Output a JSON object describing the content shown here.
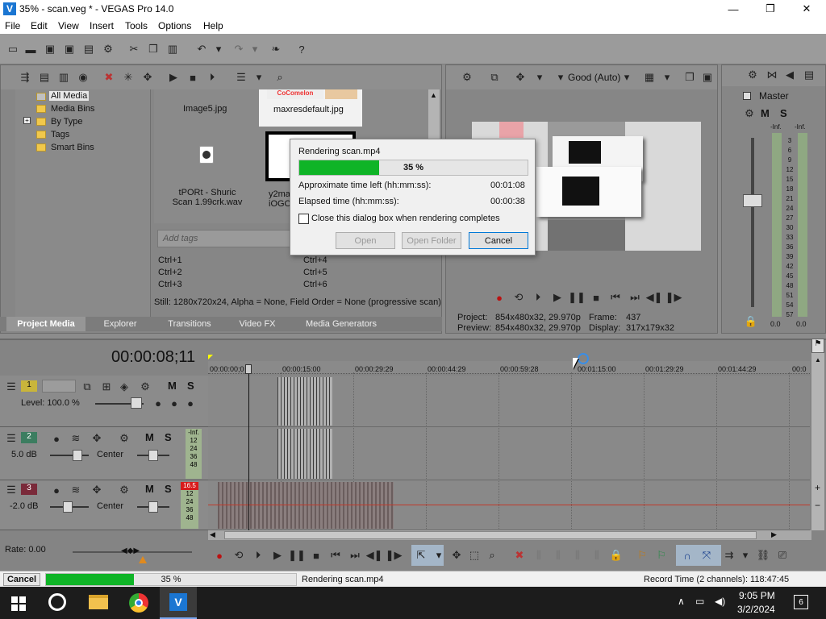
{
  "window": {
    "title": "35% - scan.veg * - VEGAS Pro 14.0",
    "minimize": "—",
    "maximize": "❐",
    "close": "✕"
  },
  "menu": [
    "File",
    "Edit",
    "View",
    "Insert",
    "Tools",
    "Options",
    "Help"
  ],
  "media_tree": [
    "All Media",
    "Media Bins",
    "By Type",
    "Tags",
    "Smart Bins"
  ],
  "tree_expand": "+",
  "media_files": [
    "Image5.jpg",
    "maxresdefault.jpg",
    "tPORt - Shuric Scan 1.99crk.wav",
    "y2ma",
    "iOGO"
  ],
  "cocomelon": "CoComelon",
  "tags": {
    "placeholder": "Add tags",
    "shortcuts": [
      "Ctrl+1",
      "Ctrl+2",
      "Ctrl+3",
      "Ctrl+4",
      "Ctrl+5",
      "Ctrl+6"
    ]
  },
  "media_status": "Still: 1280x720x24, Alpha = None, Field Order = None (progressive scan)",
  "tabs": [
    "Project Media",
    "Explorer",
    "Transitions",
    "Video FX",
    "Media Generators"
  ],
  "preview": {
    "quality": "Good (Auto)",
    "project_label": "Project:",
    "project": "854x480x32, 29.970p",
    "preview_label": "Preview:",
    "preview": "854x480x32, 29.970p",
    "frame_label": "Frame:",
    "frame": "437",
    "display_label": "Display:",
    "display": "317x179x32"
  },
  "master": {
    "label": "Master",
    "m": "M",
    "s": "S",
    "inf_l": "-Inf.",
    "inf_r": "-Inf.",
    "scale": [
      "3",
      "6",
      "9",
      "12",
      "15",
      "18",
      "21",
      "24",
      "27",
      "30",
      "33",
      "36",
      "39",
      "42",
      "45",
      "48",
      "51",
      "54",
      "57"
    ],
    "val_l": "0.0",
    "val_r": "0.0"
  },
  "timecode": "00:00:08;11",
  "ruler": [
    "00:00:00;0",
    "00:00:15:00",
    "00:00:29:29",
    "00:00:44:29",
    "00:00:59:28",
    "00:01:15:00",
    "00:01:29:29",
    "00:01:44:29",
    "00:0"
  ],
  "tracks": [
    {
      "num": "1",
      "level": "Level: 100.0 %",
      "m": "M",
      "s": "S"
    },
    {
      "num": "2",
      "vol": "5.0 dB",
      "pan": "Center",
      "m": "M",
      "s": "S",
      "meter": "-Inf.",
      "scale": [
        "12",
        "24",
        "36",
        "48"
      ]
    },
    {
      "num": "3",
      "vol": "-2.0 dB",
      "pan": "Center",
      "m": "M",
      "s": "S",
      "meter": "16.5",
      "scale": [
        "12",
        "24",
        "36",
        "48"
      ]
    }
  ],
  "rate": "Rate: 0.00",
  "status": {
    "cancel": "Cancel",
    "progress_text": "35 %",
    "progress": 0.35,
    "message": "Rendering scan.mp4",
    "record_time": "Record Time (2 channels): 118:47:45"
  },
  "dialog": {
    "title": "Rendering scan.mp4",
    "progress_text": "35 %",
    "progress": 0.35,
    "time_left_label": "Approximate time left (hh:mm:ss):",
    "time_left": "00:01:08",
    "elapsed_label": "Elapsed time (hh:mm:ss):",
    "elapsed": "00:00:38",
    "close_checkbox": "Close this dialog box when rendering completes",
    "open": "Open",
    "open_folder": "Open Folder",
    "cancel": "Cancel"
  },
  "taskbar": {
    "time": "9:05 PM",
    "date": "3/2/2024",
    "notifications": "6"
  },
  "colors": {
    "progress": "#0fb427",
    "accent": "#1b76d2",
    "taskbar": "#1c1c1c"
  }
}
